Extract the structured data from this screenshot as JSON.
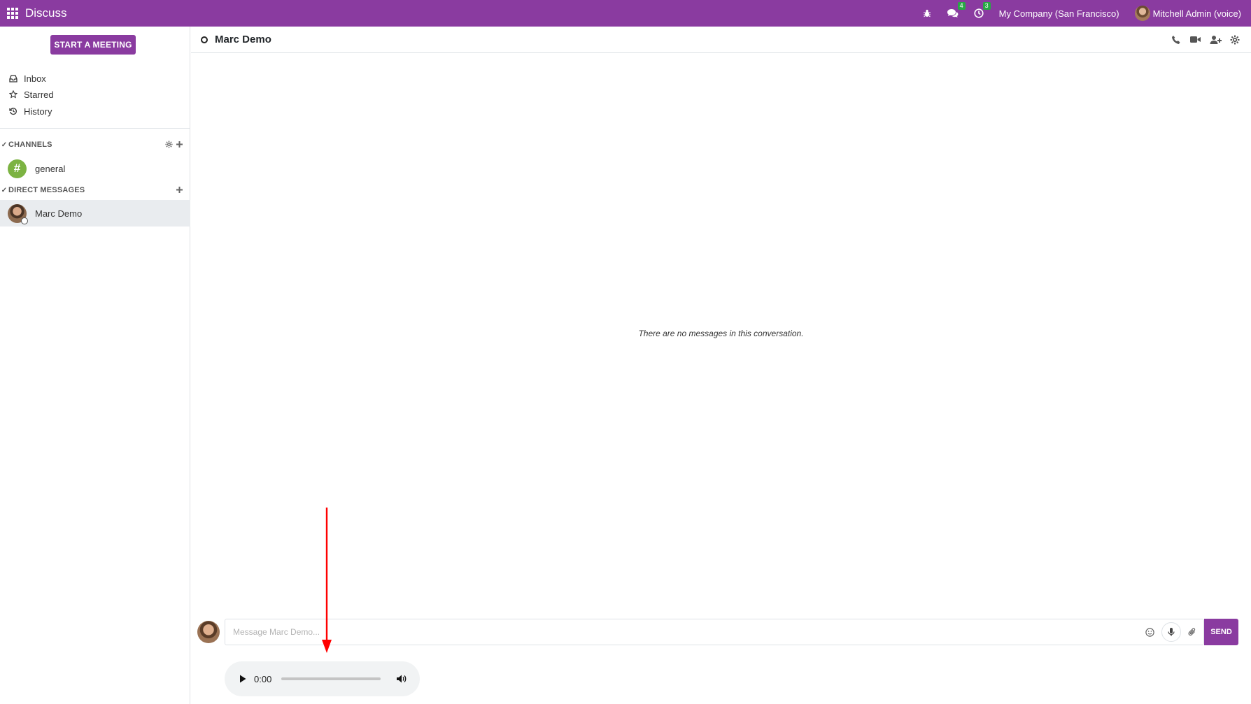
{
  "navbar": {
    "app_title": "Discuss",
    "bug_icon": "bug-icon",
    "messages_badge": "4",
    "activities_badge": "3",
    "company": "My Company (San Francisco)",
    "user": "Mitchell Admin (voice)"
  },
  "sidebar": {
    "start_meeting": "START A MEETING",
    "mailboxes": [
      {
        "label": "Inbox",
        "icon": "inbox-icon"
      },
      {
        "label": "Starred",
        "icon": "star-icon"
      },
      {
        "label": "History",
        "icon": "history-icon"
      }
    ],
    "channels_header": "CHANNELS",
    "channels": [
      {
        "name": "general",
        "avatar": "#"
      }
    ],
    "dm_header": "DIRECT MESSAGES",
    "direct_messages": [
      {
        "name": "Marc Demo"
      }
    ]
  },
  "thread": {
    "name": "Marc Demo",
    "empty_text": "There are no messages in this conversation."
  },
  "composer": {
    "placeholder": "Message Marc Demo...",
    "send_label": "SEND"
  },
  "audio": {
    "time": "0:00"
  },
  "colors": {
    "brand": "#8a3ba0",
    "badge": "#28a745",
    "channel_avatar": "#7cb342",
    "annotation": "#ff0000"
  }
}
